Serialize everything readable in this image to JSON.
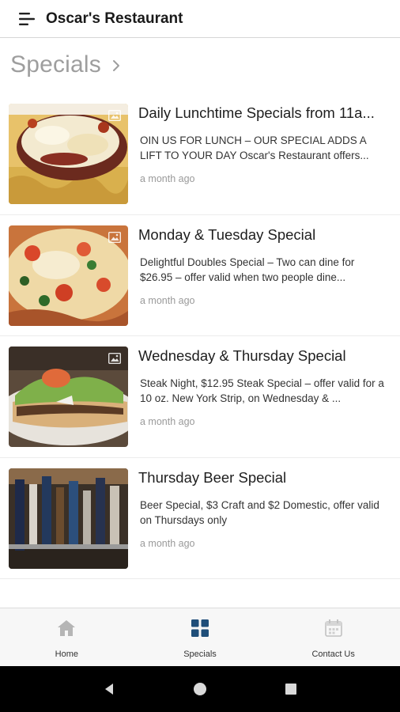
{
  "app": {
    "title": "Oscar's Restaurant",
    "menu_icon": "menu-icon"
  },
  "section": {
    "title": "Specials",
    "chevron_icon": "chevron-right-icon"
  },
  "posts": [
    {
      "title": "Daily Lunchtime Specials from 11a...",
      "excerpt": "OIN US FOR LUNCH – OUR SPECIAL ADDS A LIFT TO YOUR DAY Oscar's Restaurant offers...",
      "time": "a month ago",
      "image": "chicken-parmesan-photo"
    },
    {
      "title": "Monday & Tuesday Special",
      "excerpt": "Delightful Doubles Special – Two can dine for $26.95 – offer valid when two people dine...",
      "time": "a month ago",
      "image": "pizza-photo"
    },
    {
      "title": "Wednesday & Thursday Special",
      "excerpt": "Steak Night, $12.95 Steak Special – offer valid for a 10 oz. New York Strip, on Wednesday & ...",
      "time": "a month ago",
      "image": "steak-sandwich-photo"
    },
    {
      "title": "Thursday Beer Special",
      "excerpt": "Beer Special, $3 Craft and $2 Domestic, offer valid on Thursdays only",
      "time": "a month ago",
      "image": "beer-taps-photo"
    }
  ],
  "bottom_nav": {
    "items": [
      {
        "label": "Home",
        "icon": "home-icon",
        "active": false
      },
      {
        "label": "Specials",
        "icon": "grid-icon",
        "active": true
      },
      {
        "label": "Contact Us",
        "icon": "calendar-icon",
        "active": false
      }
    ],
    "active_color": "#1f4e79",
    "inactive_color": "#b5b5b5"
  },
  "system_nav": {
    "back_icon": "back-triangle-icon",
    "home_icon": "home-circle-icon",
    "recents_icon": "recents-square-icon"
  }
}
